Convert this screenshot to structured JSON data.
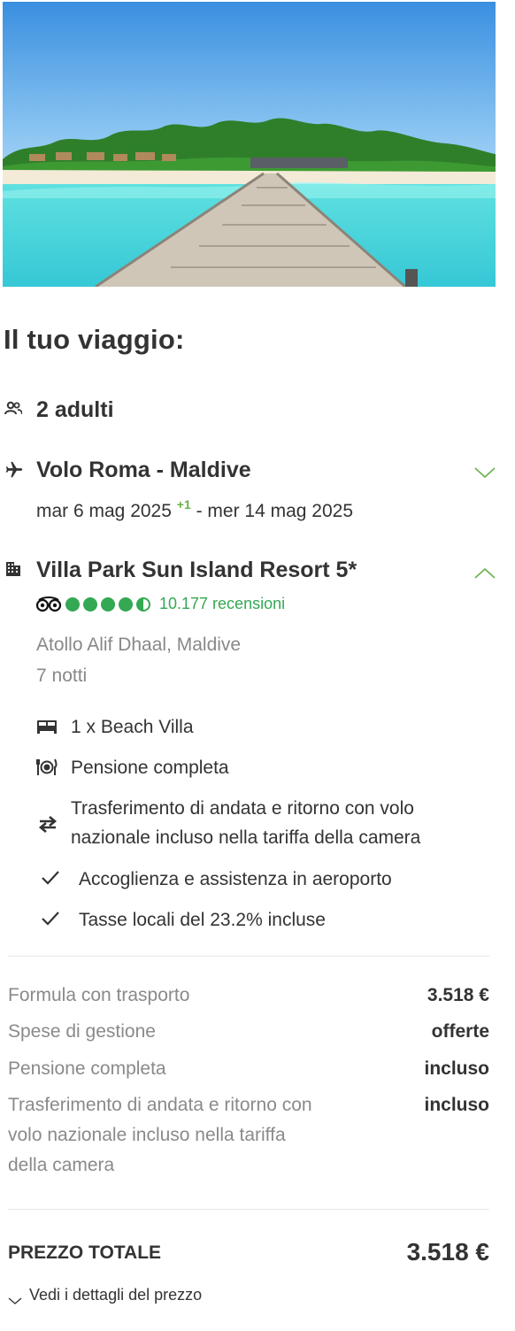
{
  "colors": {
    "text": "#333333",
    "muted": "#888888",
    "accent_green": "#6ab04c",
    "rating_green": "#34a853"
  },
  "hero": {
    "image": "beach-pier-photo"
  },
  "section_title": "Il tuo viaggio:",
  "travelers": {
    "icon": "people-icon",
    "label": "2 adulti"
  },
  "flight": {
    "icon": "airplane-icon",
    "title": "Volo Roma - Maldive",
    "depart": "mar 6 mag 2025",
    "plus_day": "+1",
    "return": "- mer 14 mag 2025",
    "toggle_icon": "chevron-down-icon"
  },
  "hotel": {
    "icon": "building-icon",
    "title": "Villa Park Sun Island Resort 5*",
    "toggle_icon": "chevron-up-icon",
    "rating": {
      "source_icon": "tripadvisor-icon",
      "score": 4.5,
      "max": 5,
      "reviews": "10.177 recensioni"
    },
    "location": "Atollo Alif Dhaal, Maldive",
    "nights": "7 notti",
    "features": [
      {
        "icon": "bed-icon",
        "text": "1 x Beach Villa"
      },
      {
        "icon": "dining-icon",
        "text": "Pensione completa"
      },
      {
        "icon": "transfer-arrows-icon",
        "text": "Trasferimento di andata e ritorno con volo nazionale incluso nella tariffa della camera"
      },
      {
        "icon": "check-icon",
        "text": "Accoglienza e assistenza in aeroporto"
      },
      {
        "icon": "check-icon",
        "text": "Tasse locali del 23.2% incluse"
      }
    ]
  },
  "price_lines": [
    {
      "label": "Formula con trasporto",
      "value": "3.518 €"
    },
    {
      "label": "Spese di gestione",
      "value": "offerte"
    },
    {
      "label": "Pensione completa",
      "value": "incluso"
    },
    {
      "label": "Trasferimento di andata e ritorno con volo nazionale incluso nella tariffa della camera",
      "value": "incluso"
    }
  ],
  "total": {
    "label": "PREZZO TOTALE",
    "value": "3.518 €"
  },
  "details_link": {
    "icon": "chevron-down-icon",
    "label": "Vedi i dettagli del prezzo"
  }
}
